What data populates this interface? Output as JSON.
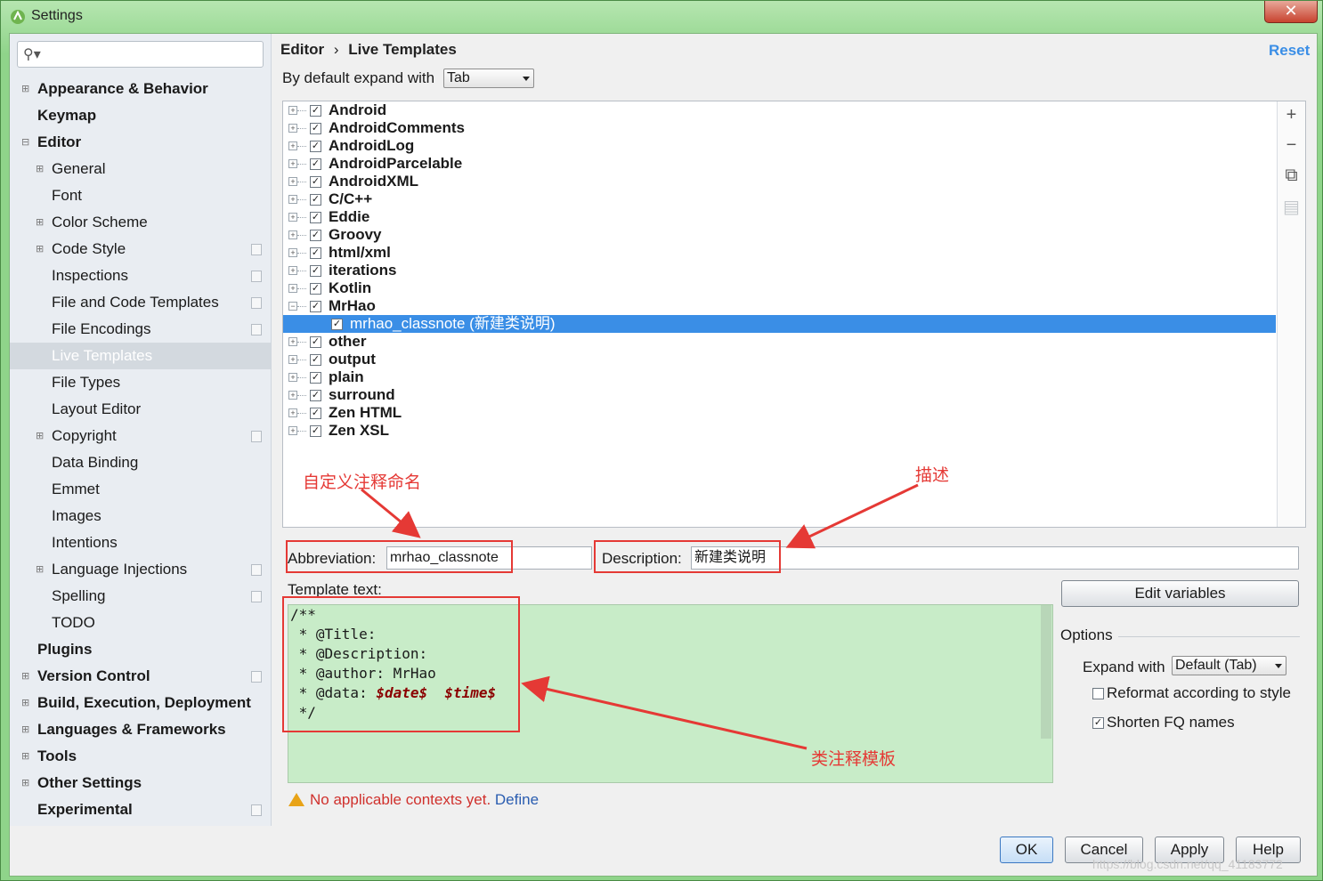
{
  "window": {
    "title": "Settings",
    "close_label": "✕"
  },
  "search": {
    "placeholder": ""
  },
  "nav": [
    {
      "label": "Appearance & Behavior",
      "bold": true,
      "level": 0,
      "expand": "+"
    },
    {
      "label": "Keymap",
      "bold": true,
      "level": 0,
      "expand": ""
    },
    {
      "label": "Editor",
      "bold": true,
      "level": 0,
      "expand": "−"
    },
    {
      "label": "General",
      "bold": false,
      "level": 1,
      "expand": "+"
    },
    {
      "label": "Font",
      "bold": false,
      "level": 1,
      "expand": ""
    },
    {
      "label": "Color Scheme",
      "bold": false,
      "level": 1,
      "expand": "+"
    },
    {
      "label": "Code Style",
      "bold": false,
      "level": 1,
      "expand": "+",
      "project": true
    },
    {
      "label": "Inspections",
      "bold": false,
      "level": 1,
      "expand": "",
      "project": true
    },
    {
      "label": "File and Code Templates",
      "bold": false,
      "level": 1,
      "expand": "",
      "project": true
    },
    {
      "label": "File Encodings",
      "bold": false,
      "level": 1,
      "expand": "",
      "project": true
    },
    {
      "label": "Live Templates",
      "bold": false,
      "level": 1,
      "expand": "",
      "selected": true
    },
    {
      "label": "File Types",
      "bold": false,
      "level": 1,
      "expand": ""
    },
    {
      "label": "Layout Editor",
      "bold": false,
      "level": 1,
      "expand": ""
    },
    {
      "label": "Copyright",
      "bold": false,
      "level": 1,
      "expand": "+",
      "project": true
    },
    {
      "label": "Data Binding",
      "bold": false,
      "level": 1,
      "expand": ""
    },
    {
      "label": "Emmet",
      "bold": false,
      "level": 1,
      "expand": ""
    },
    {
      "label": "Images",
      "bold": false,
      "level": 1,
      "expand": ""
    },
    {
      "label": "Intentions",
      "bold": false,
      "level": 1,
      "expand": ""
    },
    {
      "label": "Language Injections",
      "bold": false,
      "level": 1,
      "expand": "+",
      "project": true
    },
    {
      "label": "Spelling",
      "bold": false,
      "level": 1,
      "expand": "",
      "project": true
    },
    {
      "label": "TODO",
      "bold": false,
      "level": 1,
      "expand": ""
    },
    {
      "label": "Plugins",
      "bold": true,
      "level": 0,
      "expand": ""
    },
    {
      "label": "Version Control",
      "bold": true,
      "level": 0,
      "expand": "+",
      "project": true
    },
    {
      "label": "Build, Execution, Deployment",
      "bold": true,
      "level": 0,
      "expand": "+"
    },
    {
      "label": "Languages & Frameworks",
      "bold": true,
      "level": 0,
      "expand": "+"
    },
    {
      "label": "Tools",
      "bold": true,
      "level": 0,
      "expand": "+"
    },
    {
      "label": "Other Settings",
      "bold": true,
      "level": 0,
      "expand": "+"
    },
    {
      "label": "Experimental",
      "bold": true,
      "level": 0,
      "expand": "",
      "project": true
    }
  ],
  "breadcrumb": {
    "parent": "Editor",
    "sep": "›",
    "current": "Live Templates"
  },
  "reset_label": "Reset",
  "expand_default": {
    "label": "By default expand with",
    "value": "Tab"
  },
  "template_groups": [
    {
      "name": "Android",
      "checked": true,
      "toggle": "+"
    },
    {
      "name": "AndroidComments",
      "checked": true,
      "toggle": "+"
    },
    {
      "name": "AndroidLog",
      "checked": true,
      "toggle": "+"
    },
    {
      "name": "AndroidParcelable",
      "checked": true,
      "toggle": "+"
    },
    {
      "name": "AndroidXML",
      "checked": true,
      "toggle": "+"
    },
    {
      "name": "C/C++",
      "checked": true,
      "toggle": "+"
    },
    {
      "name": "Eddie",
      "checked": true,
      "toggle": "+"
    },
    {
      "name": "Groovy",
      "checked": true,
      "toggle": "+"
    },
    {
      "name": "html/xml",
      "checked": true,
      "toggle": "+"
    },
    {
      "name": "iterations",
      "checked": true,
      "toggle": "+"
    },
    {
      "name": "Kotlin",
      "checked": true,
      "toggle": "+"
    },
    {
      "name": "MrHao",
      "checked": true,
      "toggle": "−"
    },
    {
      "name": "mrhao_classnote (新建类说明)",
      "checked": true,
      "toggle": "",
      "child": true,
      "selected": true
    },
    {
      "name": "other",
      "checked": true,
      "toggle": "+"
    },
    {
      "name": "output",
      "checked": true,
      "toggle": "+"
    },
    {
      "name": "plain",
      "checked": true,
      "toggle": "+"
    },
    {
      "name": "surround",
      "checked": true,
      "toggle": "+"
    },
    {
      "name": "Zen HTML",
      "checked": true,
      "toggle": "+"
    },
    {
      "name": "Zen XSL",
      "checked": true,
      "toggle": "+"
    }
  ],
  "side_tools": [
    {
      "name": "add-icon",
      "glyph": "+"
    },
    {
      "name": "remove-icon",
      "glyph": "−"
    },
    {
      "name": "copy-icon",
      "glyph": "⧉"
    },
    {
      "name": "restore-icon",
      "glyph": "▤"
    }
  ],
  "abbreviation": {
    "label": "Abbreviation:",
    "value": "mrhao_classnote"
  },
  "description": {
    "label": "Description:",
    "value": "新建类说明"
  },
  "template_text_label": "Template text:",
  "template_lines": [
    "/**",
    " * @Title:",
    " * @Description:",
    " * @author: MrHao",
    " * @data: ",
    " */"
  ],
  "template_vars": [
    "$date$",
    "$time$"
  ],
  "edit_variables_label": "Edit variables",
  "options": {
    "title": "Options",
    "expand_with_label": "Expand with",
    "expand_with_value": "Default (Tab)",
    "reformat_label": "Reformat according to style",
    "reformat_checked": false,
    "shorten_label": "Shorten FQ names",
    "shorten_checked": true
  },
  "warning": {
    "text": "No applicable contexts yet.",
    "link": "Define"
  },
  "annotations": {
    "abbr_note": "自定义注释命名",
    "desc_note": "描述",
    "template_note": "类注释模板"
  },
  "footer": {
    "ok": "OK",
    "cancel": "Cancel",
    "apply": "Apply",
    "help": "Help"
  },
  "watermark": "https://blog.csdn.net/qq_41183772",
  "colors": {
    "accent": "#3a8ee6",
    "annotation": "#e53935",
    "editor_bg": "#c8ecc8",
    "variable": "#8b0000"
  }
}
